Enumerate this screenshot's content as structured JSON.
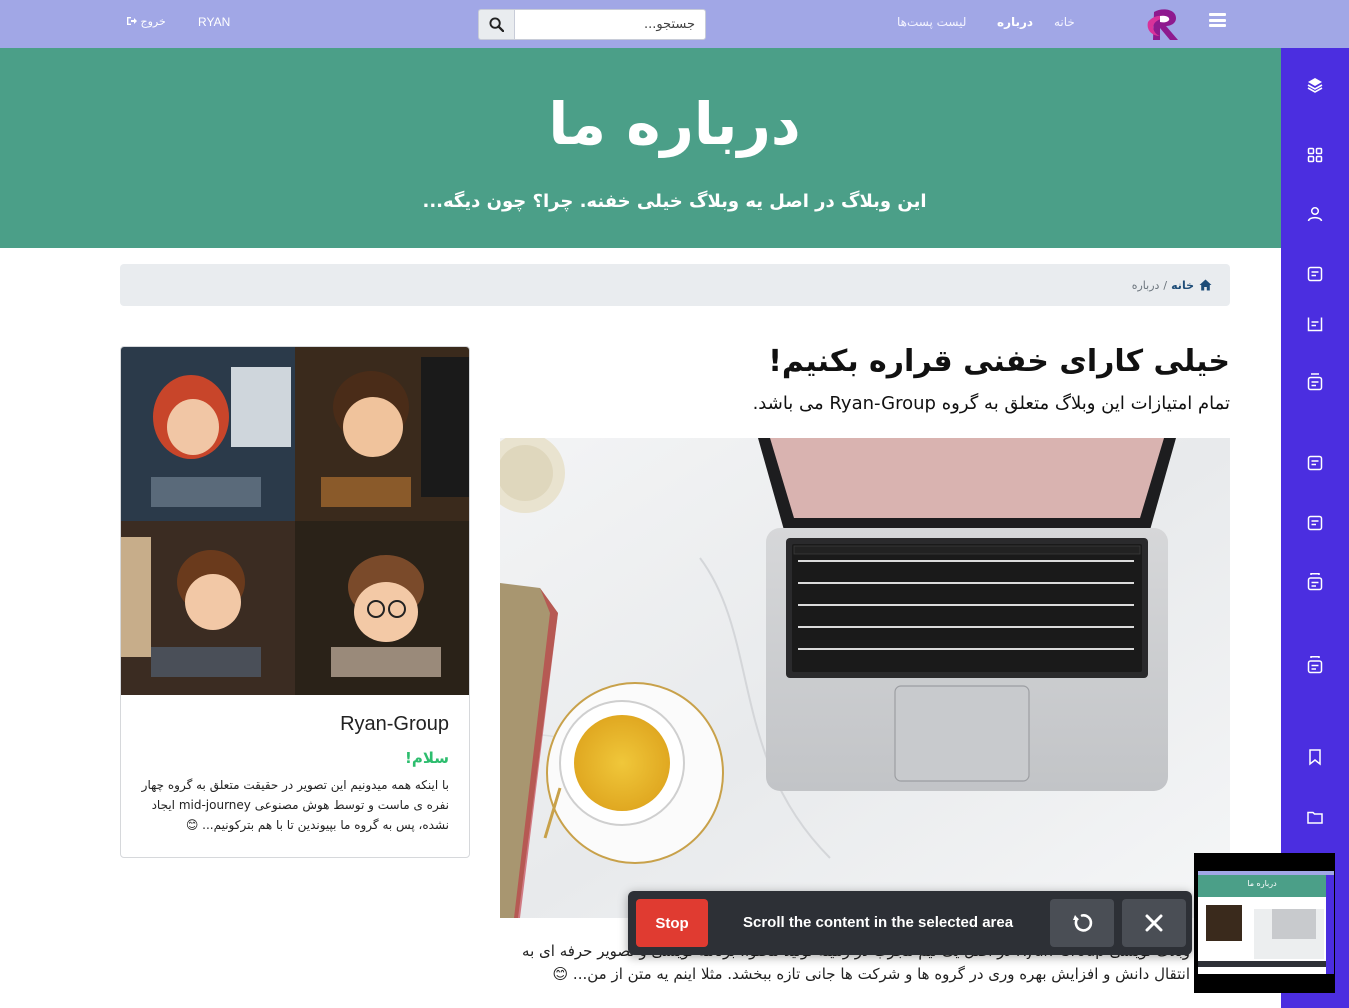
{
  "navbar": {
    "links": [
      {
        "label": "خانه"
      },
      {
        "label": "درباره"
      },
      {
        "label": "لیست پست‌ها"
      }
    ],
    "search": {
      "placeholder": "جستجو..."
    },
    "user": "RYAN",
    "logout": "خروج",
    "icons": [
      "menu-icon",
      "logo-icon",
      "search-icon",
      "logout-icon"
    ]
  },
  "sidebar": {
    "icons": [
      "layers-icon",
      "grid-icon",
      "user-icon",
      "note-icon",
      "note-edit-icon",
      "note-icon",
      "note-icon",
      "note-icon",
      "note-icon",
      "note-icon",
      "bookmark-icon",
      "folder-icon"
    ]
  },
  "hero": {
    "title": "درباره ما",
    "subtitle": "این وبلاگ در اصل یه وبلاگ خیلی خفنه. چرا؟ چون دیگه..."
  },
  "breadcrumb": {
    "home": "خانه",
    "separator": "/",
    "current": "درباره"
  },
  "main": {
    "title": "خیلی کارای خفنی قراره بکنیم!",
    "subtitle": "تمام امتیازات این وبلاگ متعلق به گروه Ryan-Group می باشد.",
    "body": "وبلاگ نویسی Ryan-Group در اصل یک تیم مجرب در زمینه تولید محتوا، برنامه نویسی و تصویر حرفه ای به انتقال دانش و افزایش بهره وری در گروه ها و شرکت ها جانی تازه ببخشد. مثلا اینم یه متن از من... 😊"
  },
  "card": {
    "title": "Ryan-Group",
    "subtitle": "سلام!",
    "text": "با اینکه همه میدونیم این تصویر در حقیقت متعلق به گروه چهار نفره ی ماست و توسط هوش مصنوعی mid-journey ایجاد نشده، پس به گروه ما بپیوندین تا با هم بترکونیم... 😊"
  },
  "overlay": {
    "stop": "Stop",
    "message": "Scroll the content in the selected area",
    "icons": [
      "refresh-icon",
      "close-icon"
    ]
  },
  "thumbnail": {
    "title": "درباره ما"
  },
  "colors": {
    "navbar": "#a1a7e6",
    "sidebar": "#4b2ee0",
    "hero": "#4b9f88",
    "stop": "#e03b31",
    "greeting": "#2dbd6e"
  }
}
